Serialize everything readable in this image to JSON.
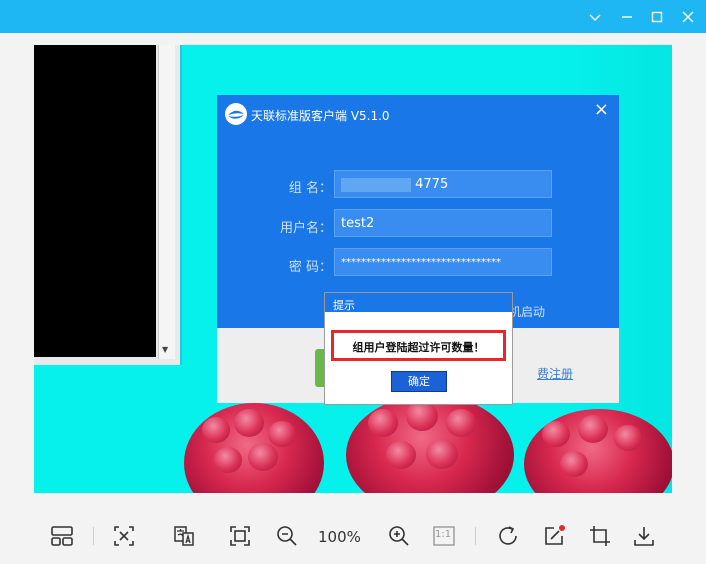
{
  "window": {
    "controls": {
      "minimize": "minimize",
      "maximize": "maximize",
      "close": "close"
    }
  },
  "login_dialog": {
    "title": "天联标准版客户端 V5.1.0",
    "fields": [
      {
        "label": "组  名：",
        "value": "4775"
      },
      {
        "label": "用户名：",
        "value": "test2"
      },
      {
        "label": "密  码：",
        "value": "********************************"
      }
    ],
    "autostart_partial": "机启动",
    "register_partial": "费注册"
  },
  "alert": {
    "title": "提示",
    "message": "组用户登陆超过许可数量！",
    "ok_label": "确定"
  },
  "toolbar": {
    "zoom": "100%",
    "actual_size": "1:1"
  },
  "colors": {
    "titlebar": "#1eb6f3",
    "dialog_blue": "#1a77e8",
    "highlight_red": "#e8262c",
    "background_cyan": "#06f1ec"
  }
}
